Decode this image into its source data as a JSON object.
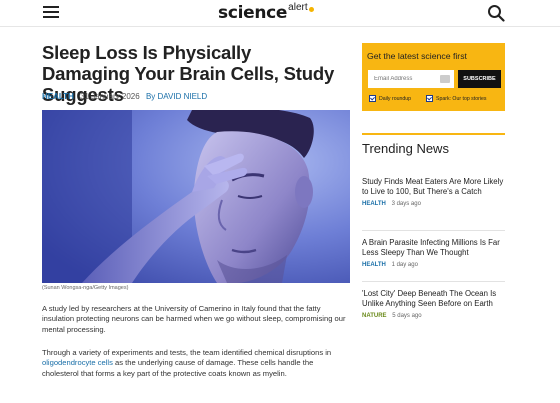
{
  "header": {
    "logo_main": "science",
    "logo_alert": "alert"
  },
  "article": {
    "headline": "Sleep Loss Is Physically Damaging Your Brain Cells, Study Suggests",
    "category": "HEALTH",
    "date": "31 January 2026",
    "by": "By",
    "author": "DAVID NIELD",
    "image_caption": "(Sunan Wongsa-nga/Getty Images)",
    "p1": "A study led by researchers at the University of Camerino in Italy found that the fatty insulation protecting neurons can be harmed when we go without sleep, compromising our mental processing.",
    "p2_before": "Through a variety of experiments and tests, the team identified chemical disruptions in ",
    "p2_link": "oligodendrocyte cells",
    "p2_after": " as the underlying cause of damage. These cells handle the cholesterol that forms a key part of the protective coats known as myelin."
  },
  "newsletter": {
    "title": "Get the latest science first",
    "email_placeholder": "Email Address",
    "subscribe_label": "SUBSCRIBE",
    "option1": "Daily roundup",
    "option2": "Spark: Our top stories"
  },
  "trending": {
    "title": "Trending News",
    "items": [
      {
        "title": "Study Finds Meat Eaters Are More Likely to Live to 100, But There's a Catch",
        "category": "HEALTH",
        "time": "3 days ago",
        "color": "#1a6fa8"
      },
      {
        "title": "A Brain Parasite Infecting Millions Is Far Less Sleepy Than We Thought",
        "category": "HEALTH",
        "time": "1 day ago",
        "color": "#1a6fa8"
      },
      {
        "title": "'Lost City' Deep Beneath The Ocean Is Unlike Anything Seen Before on Earth",
        "category": "NATURE",
        "time": "5 days ago",
        "color": "#6a8a1a"
      }
    ]
  },
  "colors": {
    "accent": "#f8b612",
    "link": "#1a6fa8"
  }
}
